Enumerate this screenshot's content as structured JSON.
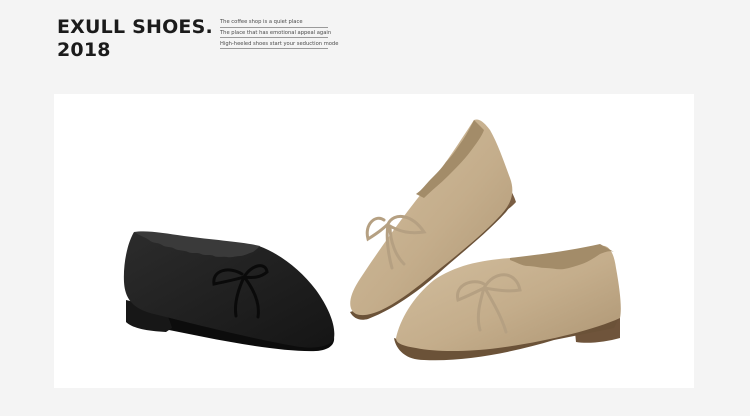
{
  "header": {
    "brand_line1": "EXULL SHOES.",
    "brand_line2": "2018",
    "tagline": [
      "The coffee shop is a quiet place",
      "The place that has emotional appeal again",
      "High-heeled shoes start your seduction mode"
    ]
  },
  "product_image": {
    "subject": "suede scalloped loafers with bow",
    "colors": {
      "black_shoe": "#1f1f1f",
      "khaki_shoe": "#c6b08f",
      "heel": "#7a5e43"
    }
  }
}
